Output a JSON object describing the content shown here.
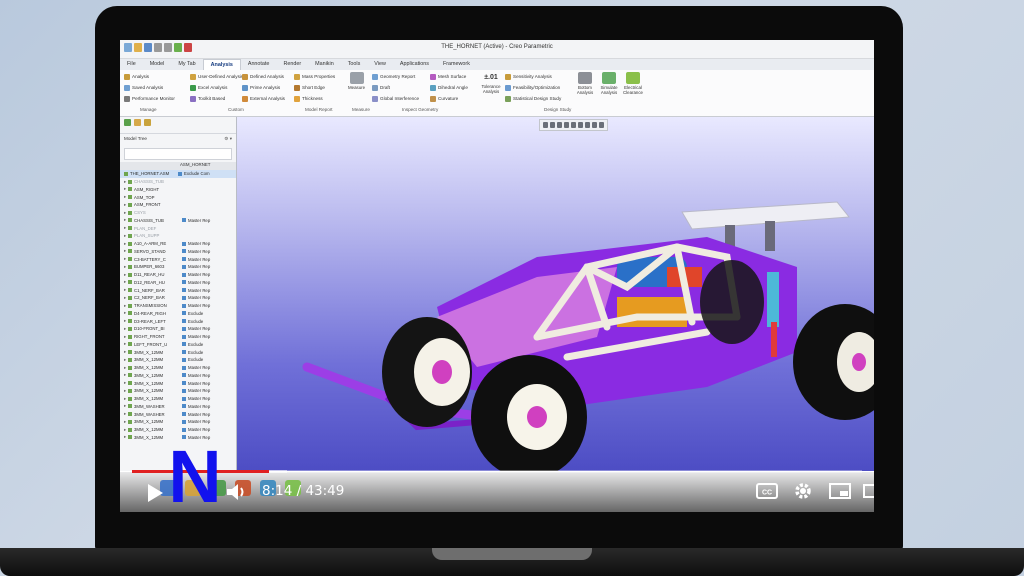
{
  "window": {
    "title": "THE_HORNET (Active) - Creo Parametric"
  },
  "ribbon_tabs": [
    "File",
    "Model",
    "My Tab",
    "Analysis",
    "Annotate",
    "Render",
    "Manikin",
    "Tools",
    "View",
    "Applications",
    "Framework"
  ],
  "active_tab": "Analysis",
  "ribbon": {
    "manage": [
      "Analysis",
      "Saved Analysis",
      "Performance Monitor"
    ],
    "custom": [
      "User-Defined Analysis",
      "Excel Analysis",
      "Toolkit Based"
    ],
    "custom2": [
      "Defined Analysis",
      "Prime Analysis",
      "External Analysis"
    ],
    "model_report": [
      "Mass Properties",
      "Short Edge",
      "Thickness"
    ],
    "measure_label": "Measure",
    "inspect1": [
      "Geometry Report",
      "Draft",
      "Global Interference"
    ],
    "inspect2": [
      "Mesh Surface",
      "Dihedral Angle",
      "Curvature"
    ],
    "tolerance_label": "Tolerance Analysis",
    "tolerance_value": "±.01",
    "design_study": [
      "Sensitivity Analysis",
      "Feasibility/Optimization",
      "Statistical Design Study"
    ],
    "design_big": [
      "Bottom Analysis",
      "Simulate Analysis",
      "Electrical Clearance"
    ],
    "groups": [
      "Manage",
      "Custom",
      "Model Report",
      "Measure",
      "Inspect Geometry",
      "Design Study"
    ]
  },
  "model_tree": {
    "header": "Model Tree",
    "column": "ASM_HORNET",
    "root": "THE_HORNET.ASM",
    "root_rep": "Exclude Com",
    "rows": [
      {
        "name": "CHASSIS_TUB",
        "rep": "",
        "faded": true
      },
      {
        "name": "ASM_RIGHT",
        "rep": "",
        "faded": false
      },
      {
        "name": "ASM_TOP",
        "rep": "",
        "faded": false
      },
      {
        "name": "ASM_FRONT",
        "rep": "",
        "faded": false
      },
      {
        "name": "CSYS",
        "rep": "",
        "faded": true
      },
      {
        "name": "CHASSIS_TUB",
        "rep": "Master Rep",
        "faded": false
      },
      {
        "name": "PLAN_DEF",
        "rep": "",
        "faded": true
      },
      {
        "name": "PLAN_SUPP",
        "rep": "",
        "faded": true
      },
      {
        "name": "A10_A-ARM_RE",
        "rep": "Master Rep",
        "faded": false
      },
      {
        "name": "SERVO_STAND",
        "rep": "Master Rep",
        "faded": false
      },
      {
        "name": "C3-BATTERY_C",
        "rep": "Master Rep",
        "faded": false
      },
      {
        "name": "BUMPER_6603",
        "rep": "Master Rep",
        "faded": false
      },
      {
        "name": "D11_REAR_HU",
        "rep": "Master Rep",
        "faded": false
      },
      {
        "name": "D12_REAR_HU",
        "rep": "Master Rep",
        "faded": false
      },
      {
        "name": "C1_NERF_BAR",
        "rep": "Master Rep",
        "faded": false
      },
      {
        "name": "C2_NERF_BAR",
        "rep": "Master Rep",
        "faded": false
      },
      {
        "name": "TRANSMISSION",
        "rep": "Master Rep",
        "faded": false
      },
      {
        "name": "D4-REAR_RIGH",
        "rep": "Exclude",
        "faded": false
      },
      {
        "name": "D3-REAR_LEFT",
        "rep": "Exclude",
        "faded": false
      },
      {
        "name": "D10-FRONT_BI",
        "rep": "Master Rep",
        "faded": false
      },
      {
        "name": "RIGHT_FRONT",
        "rep": "Master Rep",
        "faded": false
      },
      {
        "name": "LEFT_FRONT_U",
        "rep": "Exclude",
        "faded": false
      },
      {
        "name": "3MM_X_12MM",
        "rep": "Exclude",
        "faded": false
      },
      {
        "name": "3MM_X_12MM",
        "rep": "Exclude",
        "faded": false
      },
      {
        "name": "3MM_X_12MM",
        "rep": "Master Rep",
        "faded": false
      },
      {
        "name": "3MM_X_12MM",
        "rep": "Master Rep",
        "faded": false
      },
      {
        "name": "3MM_X_12MM",
        "rep": "Master Rep",
        "faded": false
      },
      {
        "name": "3MM_X_12MM",
        "rep": "Master Rep",
        "faded": false
      },
      {
        "name": "3MM_X_12MM",
        "rep": "Master Rep",
        "faded": false
      },
      {
        "name": "3MM_WASHER",
        "rep": "Master Rep",
        "faded": false
      },
      {
        "name": "3MM_WASHER",
        "rep": "Master Rep",
        "faded": false
      },
      {
        "name": "3MM_X_12MM",
        "rep": "Master Rep",
        "faded": false
      },
      {
        "name": "3MM_X_12MM",
        "rep": "Master Rep",
        "faded": false
      },
      {
        "name": "3MM_X_12MM",
        "rep": "Master Rep",
        "faded": false
      }
    ]
  },
  "video": {
    "time": "8:14 / 43:49",
    "progress_fraction": 0.188,
    "brand_letter": "N",
    "accent": "#e02020",
    "brand_color": "#1212ee"
  },
  "colors": {
    "car_body": "#8a2be2",
    "car_frame": "#f0ece0",
    "viewport_bottom": "#4d4dc4"
  }
}
